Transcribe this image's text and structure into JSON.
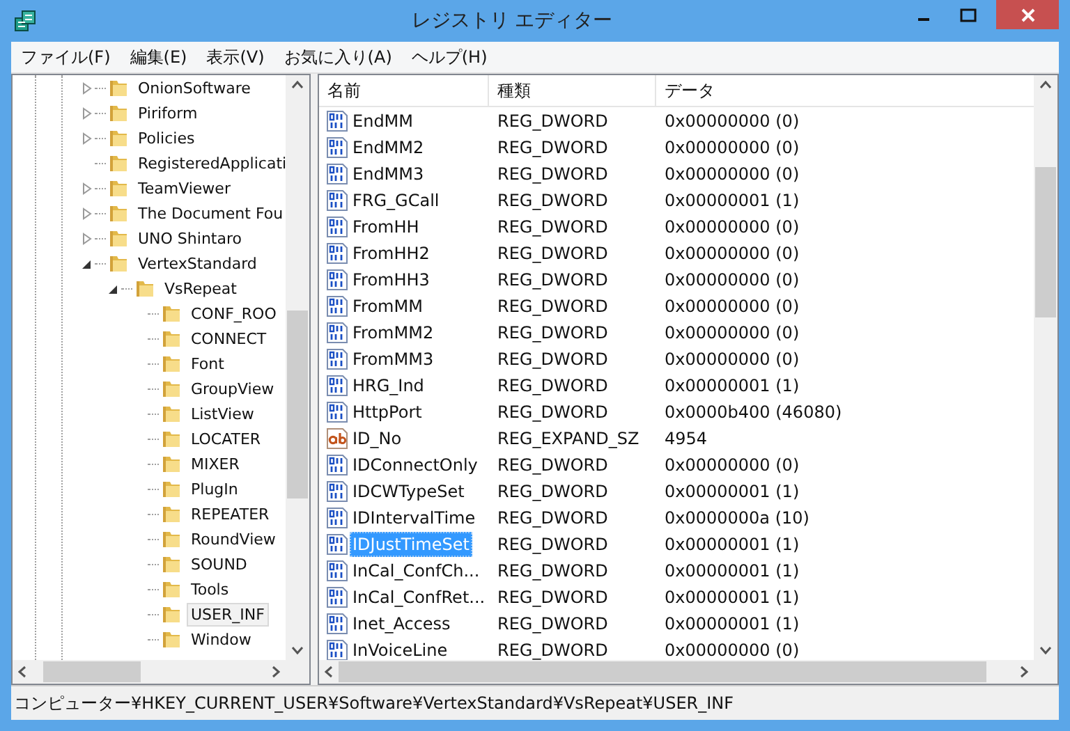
{
  "window": {
    "title": "レジストリ エディター"
  },
  "menu": [
    {
      "label": "ファイル(F)"
    },
    {
      "label": "編集(E)"
    },
    {
      "label": "表示(V)"
    },
    {
      "label": "お気に入り(A)"
    },
    {
      "label": "ヘルプ(H)"
    }
  ],
  "tree": {
    "items": [
      {
        "label": "OnionSoftware",
        "kind": "collapsed",
        "selected": false
      },
      {
        "label": "Piriform",
        "kind": "collapsed",
        "selected": false
      },
      {
        "label": "Policies",
        "kind": "collapsed",
        "selected": false
      },
      {
        "label": "RegisteredApplicati",
        "kind": "leaf",
        "selected": false
      },
      {
        "label": "TeamViewer",
        "kind": "collapsed",
        "selected": false
      },
      {
        "label": "The Document Fou",
        "kind": "collapsed",
        "selected": false
      },
      {
        "label": "UNO Shintaro",
        "kind": "collapsed",
        "selected": false
      },
      {
        "label": "VertexStandard",
        "kind": "expanded",
        "selected": false,
        "children": [
          {
            "label": "VsRepeat",
            "kind": "expanded",
            "selected": false,
            "children": [
              {
                "label": "CONF_ROO",
                "kind": "leaf",
                "selected": false
              },
              {
                "label": "CONNECT",
                "kind": "leaf",
                "selected": false
              },
              {
                "label": "Font",
                "kind": "leaf",
                "selected": false
              },
              {
                "label": "GroupView",
                "kind": "leaf",
                "selected": false
              },
              {
                "label": "ListView",
                "kind": "leaf",
                "selected": false
              },
              {
                "label": "LOCATER",
                "kind": "leaf",
                "selected": false
              },
              {
                "label": "MIXER",
                "kind": "leaf",
                "selected": false
              },
              {
                "label": "PlugIn",
                "kind": "leaf",
                "selected": false
              },
              {
                "label": "REPEATER",
                "kind": "leaf",
                "selected": false
              },
              {
                "label": "RoundView",
                "kind": "leaf",
                "selected": false
              },
              {
                "label": "SOUND",
                "kind": "leaf",
                "selected": false
              },
              {
                "label": "Tools",
                "kind": "leaf",
                "selected": false
              },
              {
                "label": "USER_INF",
                "kind": "leaf",
                "selected": true
              },
              {
                "label": "Window",
                "kind": "leaf",
                "selected": false
              }
            ]
          }
        ]
      }
    ]
  },
  "table": {
    "columns": [
      "名前",
      "種類",
      "データ"
    ],
    "rows": [
      {
        "kind": "dword",
        "name": "EndMM",
        "type": "REG_DWORD",
        "data": "0x00000000 (0)",
        "selected": false
      },
      {
        "kind": "dword",
        "name": "EndMM2",
        "type": "REG_DWORD",
        "data": "0x00000000 (0)",
        "selected": false
      },
      {
        "kind": "dword",
        "name": "EndMM3",
        "type": "REG_DWORD",
        "data": "0x00000000 (0)",
        "selected": false
      },
      {
        "kind": "dword",
        "name": "FRG_GCall",
        "type": "REG_DWORD",
        "data": "0x00000001 (1)",
        "selected": false
      },
      {
        "kind": "dword",
        "name": "FromHH",
        "type": "REG_DWORD",
        "data": "0x00000000 (0)",
        "selected": false
      },
      {
        "kind": "dword",
        "name": "FromHH2",
        "type": "REG_DWORD",
        "data": "0x00000000 (0)",
        "selected": false
      },
      {
        "kind": "dword",
        "name": "FromHH3",
        "type": "REG_DWORD",
        "data": "0x00000000 (0)",
        "selected": false
      },
      {
        "kind": "dword",
        "name": "FromMM",
        "type": "REG_DWORD",
        "data": "0x00000000 (0)",
        "selected": false
      },
      {
        "kind": "dword",
        "name": "FromMM2",
        "type": "REG_DWORD",
        "data": "0x00000000 (0)",
        "selected": false
      },
      {
        "kind": "dword",
        "name": "FromMM3",
        "type": "REG_DWORD",
        "data": "0x00000000 (0)",
        "selected": false
      },
      {
        "kind": "dword",
        "name": "HRG_Ind",
        "type": "REG_DWORD",
        "data": "0x00000001 (1)",
        "selected": false
      },
      {
        "kind": "dword",
        "name": "HttpPort",
        "type": "REG_DWORD",
        "data": "0x0000b400 (46080)",
        "selected": false
      },
      {
        "kind": "string",
        "name": "ID_No",
        "type": "REG_EXPAND_SZ",
        "data": "4954",
        "selected": false
      },
      {
        "kind": "dword",
        "name": "IDConnectOnly",
        "type": "REG_DWORD",
        "data": "0x00000000 (0)",
        "selected": false
      },
      {
        "kind": "dword",
        "name": "IDCWTypeSet",
        "type": "REG_DWORD",
        "data": "0x00000001 (1)",
        "selected": false
      },
      {
        "kind": "dword",
        "name": "IDIntervalTime",
        "type": "REG_DWORD",
        "data": "0x0000000a (10)",
        "selected": false
      },
      {
        "kind": "dword",
        "name": "IDJustTimeSet",
        "type": "REG_DWORD",
        "data": "0x00000001 (1)",
        "selected": true
      },
      {
        "kind": "dword",
        "name": "InCal_ConfCh...",
        "type": "REG_DWORD",
        "data": "0x00000001 (1)",
        "selected": false
      },
      {
        "kind": "dword",
        "name": "InCal_ConfRet...",
        "type": "REG_DWORD",
        "data": "0x00000001 (1)",
        "selected": false
      },
      {
        "kind": "dword",
        "name": "Inet_Access",
        "type": "REG_DWORD",
        "data": "0x00000001 (1)",
        "selected": false
      },
      {
        "kind": "dword",
        "name": "InVoiceLine",
        "type": "REG_DWORD",
        "data": "0x00000000 (0)",
        "selected": false
      }
    ]
  },
  "status_bar": {
    "text": "コンピューター¥HKEY_CURRENT_USER¥Software¥VertexStandard¥VsRepeat¥USER_INF"
  }
}
